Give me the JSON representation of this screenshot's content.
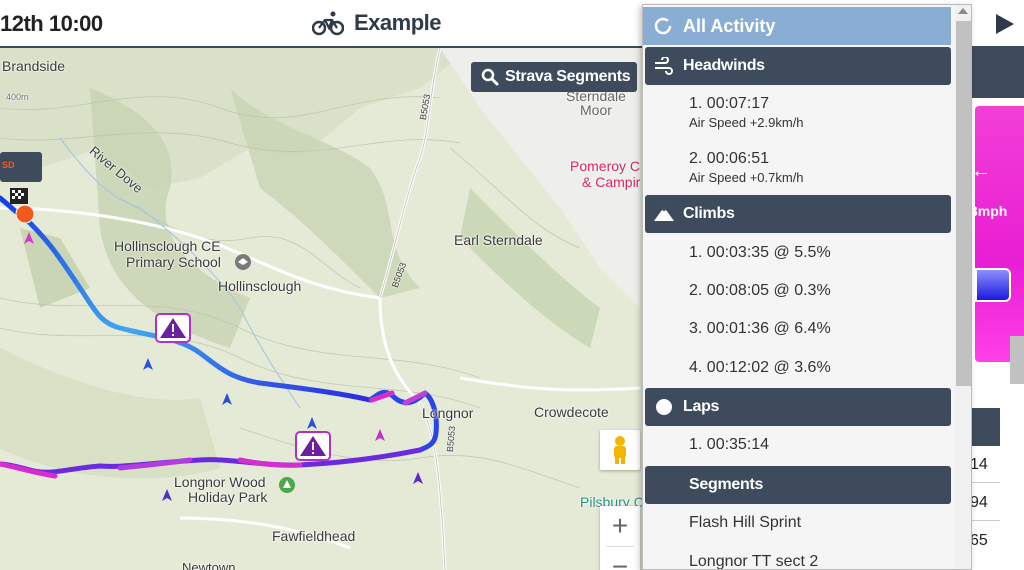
{
  "topbar": {
    "date": "12th 10:00",
    "title": "Example"
  },
  "map": {
    "places": {
      "brandside": "Brandside",
      "river_dove": "River Dove",
      "hollinsclough_school_1": "Hollinsclough CE",
      "hollinsclough_school_2": "Primary School",
      "hollinsclough": "Hollinsclough",
      "earl_sterndale": "Earl Sterndale",
      "longnor": "Longnor",
      "crowdecote": "Crowdecote",
      "longnor_wood_1": "Longnor Wood",
      "longnor_wood_2": "Holiday Park",
      "fawfieldhead": "Fawfieldhead",
      "newtown": "Newtown",
      "sterndale_moor_1": "Sterndale",
      "sterndale_moor_2": "Moor",
      "pomeroy_1": "Pomeroy C",
      "pomeroy_2": "& Campir",
      "pilsbury": "Pilsbury C",
      "road_b5053_a": "B5053",
      "road_b5053_b": "B5053",
      "road_b5053_c": "B5053",
      "contour_400": "400m"
    },
    "strava_button": "Strava Segments",
    "marker_label": "SD"
  },
  "dropdown": {
    "all_activity": "All Activity",
    "sections": {
      "headwinds": {
        "label": "Headwinds",
        "items": [
          {
            "time": "1. 00:07:17",
            "sub": "Air Speed +2.9km/h"
          },
          {
            "time": "2. 00:06:51",
            "sub": "Air Speed +0.7km/h"
          }
        ]
      },
      "climbs": {
        "label": "Climbs",
        "items": [
          "1. 00:03:35 @ 5.5%",
          "2. 00:08:05 @ 0.3%",
          "3. 00:01:36 @ 6.4%",
          "4. 00:12:02 @ 3.6%"
        ]
      },
      "laps": {
        "label": "Laps",
        "items": [
          "1. 00:35:14"
        ]
      },
      "segments": {
        "label": "Segments",
        "items": [
          "Flash Hill Sprint",
          "Longnor TT sect 2"
        ]
      }
    }
  },
  "right_panel": {
    "speed_unit": "3mph",
    "arrow": "←",
    "values": [
      "14",
      "94",
      "65"
    ]
  },
  "colors": {
    "header_dark": "#3d4b5c",
    "all_activity_bg": "#8aaed3",
    "route_blue": "#2a2ae0",
    "route_magenta": "#c41fd0",
    "map_green": "#e6ecd9"
  }
}
